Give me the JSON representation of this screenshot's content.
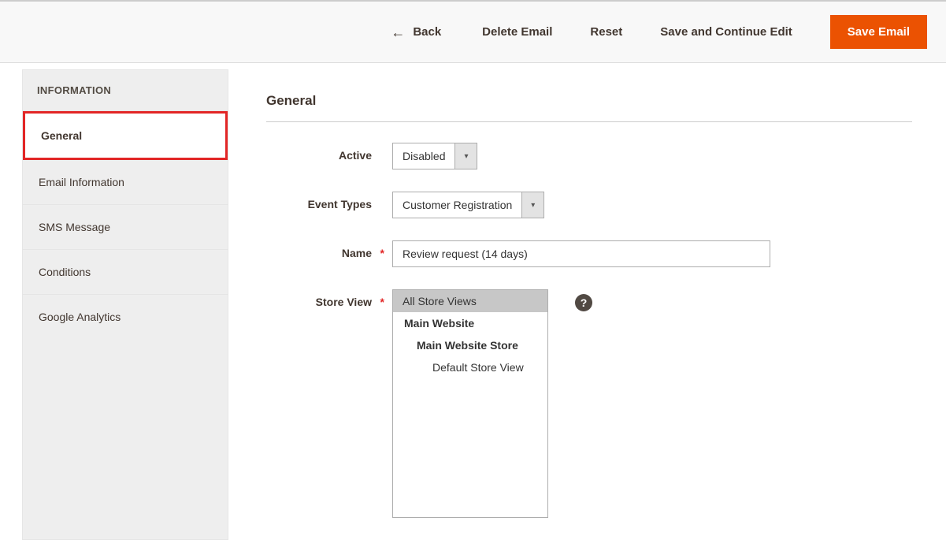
{
  "topbar": {
    "back_label": "Back",
    "delete_label": "Delete Email",
    "reset_label": "Reset",
    "save_continue_label": "Save and Continue Edit",
    "save_label": "Save Email"
  },
  "sidebar": {
    "header": "INFORMATION",
    "items": [
      {
        "label": "General"
      },
      {
        "label": "Email Information"
      },
      {
        "label": "SMS Message"
      },
      {
        "label": "Conditions"
      },
      {
        "label": "Google Analytics"
      }
    ]
  },
  "form": {
    "section_title": "General",
    "active": {
      "label": "Active",
      "value": "Disabled"
    },
    "event_types": {
      "label": "Event Types",
      "value": "Customer Registration"
    },
    "name": {
      "label": "Name",
      "value": "Review request (14 days)"
    },
    "store_view": {
      "label": "Store View",
      "options": [
        {
          "label": "All Store Views",
          "level": 0,
          "selected": true
        },
        {
          "label": "Main Website",
          "level": 1
        },
        {
          "label": "Main Website Store",
          "level": 2
        },
        {
          "label": "Default Store View",
          "level": 3
        }
      ]
    },
    "help_glyph": "?",
    "required_glyph": "*"
  }
}
